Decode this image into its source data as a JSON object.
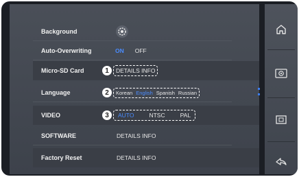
{
  "settings": {
    "background": {
      "label": "Background"
    },
    "auto_overwriting": {
      "label": "Auto-Overwriting",
      "on": "ON",
      "off": "OFF"
    },
    "micro_sd": {
      "label": "Micro-SD Card",
      "value": "DETAILS INFO"
    },
    "language": {
      "label": "Language",
      "options": [
        "Korean",
        "English",
        "Spanish",
        "Russian"
      ]
    },
    "video": {
      "label": "VIDEO",
      "options": [
        "AUTO",
        "NTSC",
        "PAL"
      ]
    },
    "software": {
      "label": "SOFTWARE",
      "value": "DETAILS INFO"
    },
    "factory_reset": {
      "label": "Factory Reset",
      "value": "DETAILS INFO"
    }
  },
  "callouts": [
    "1",
    "2",
    "3"
  ],
  "sidebar": {
    "icons": [
      "home-icon",
      "settings-camera-icon",
      "monitor-icon",
      "back-icon"
    ]
  },
  "colors": {
    "accent": "#4a8cff",
    "panel": "#454a53"
  }
}
